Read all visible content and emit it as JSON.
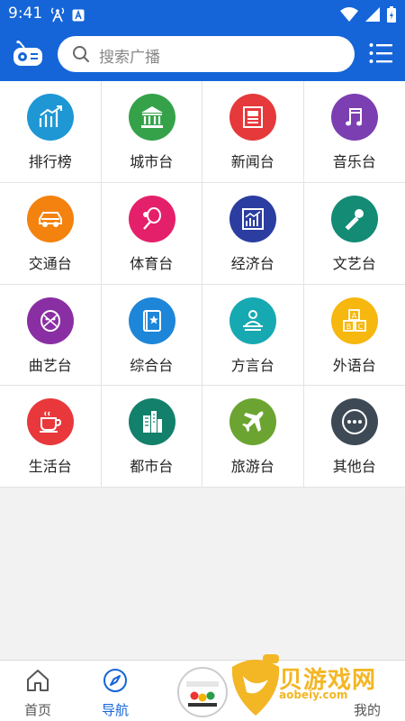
{
  "status_bar": {
    "time": "9:41"
  },
  "search": {
    "placeholder": "搜索广播"
  },
  "categories": [
    {
      "label": "排行榜",
      "color": "#1e97d4",
      "icon": "chart-up-icon"
    },
    {
      "label": "城市台",
      "color": "#35a24a",
      "icon": "building-pillars-icon"
    },
    {
      "label": "新闻台",
      "color": "#e6393b",
      "icon": "newspaper-icon"
    },
    {
      "label": "音乐台",
      "color": "#7b3fb2",
      "icon": "music-note-icon"
    },
    {
      "label": "交通台",
      "color": "#f4820f",
      "icon": "car-icon"
    },
    {
      "label": "体育台",
      "color": "#e5206b",
      "icon": "racket-ball-icon"
    },
    {
      "label": "经济台",
      "color": "#2b3da0",
      "icon": "chart-bar-icon"
    },
    {
      "label": "文艺台",
      "color": "#138b75",
      "icon": "microphone-icon"
    },
    {
      "label": "曲艺台",
      "color": "#8a2fa3",
      "icon": "opera-mask-icon"
    },
    {
      "label": "综合台",
      "color": "#1e86d8",
      "icon": "book-star-icon"
    },
    {
      "label": "方言台",
      "color": "#17a9b2",
      "icon": "speaker-person-icon"
    },
    {
      "label": "外语台",
      "color": "#f6b70e",
      "icon": "abc-blocks-icon"
    },
    {
      "label": "生活台",
      "color": "#e8383b",
      "icon": "coffee-cup-icon"
    },
    {
      "label": "都市台",
      "color": "#12806b",
      "icon": "city-buildings-icon"
    },
    {
      "label": "旅游台",
      "color": "#6ca431",
      "icon": "airplane-icon"
    },
    {
      "label": "其他台",
      "color": "#3d4a55",
      "icon": "more-dots-icon"
    }
  ],
  "bottom_nav": {
    "home": "首页",
    "guide": "导航",
    "mine": "我的"
  },
  "watermark": {
    "title": "贝游戏网",
    "url": "aobeiy.com"
  },
  "colors": {
    "brand": "#1565d8",
    "active_tab": "#1565d8"
  }
}
